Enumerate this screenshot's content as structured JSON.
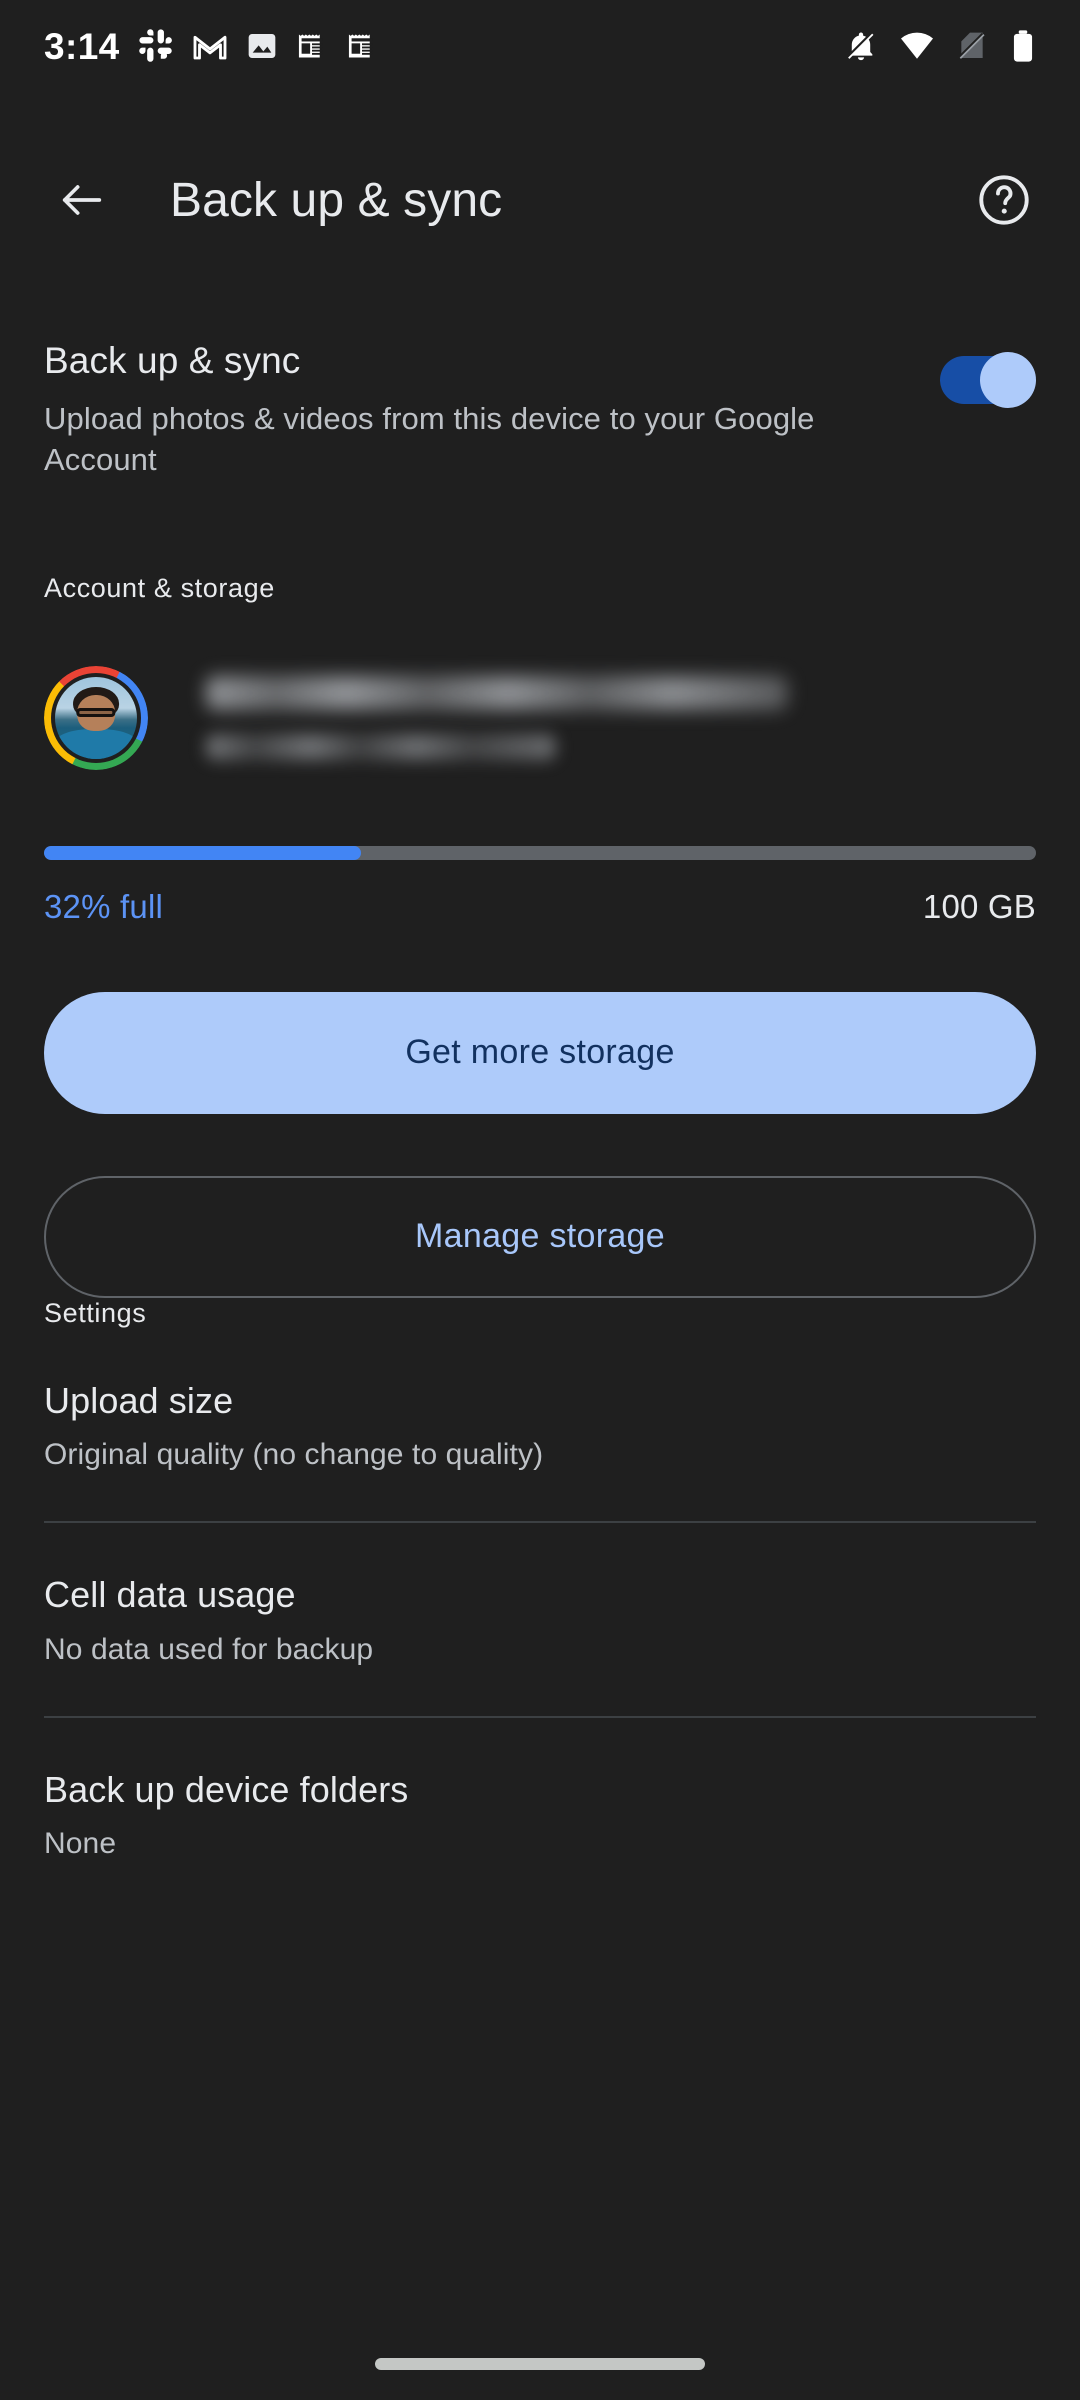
{
  "statusbar": {
    "time": "3:14",
    "left_icons": [
      "slack-icon",
      "gmail-icon",
      "photos-image-icon",
      "news-icon",
      "news-icon-2"
    ],
    "right_icons": [
      "notifications-silenced-icon",
      "wifi-icon",
      "no-sim-icon",
      "battery-full-icon"
    ]
  },
  "appbar": {
    "back_label": "Back",
    "title": "Back up & sync",
    "help_label": "Help"
  },
  "master": {
    "title": "Back up & sync",
    "subtitle": "Upload photos & videos from this device to your Google Account",
    "toggle_state": "on",
    "toggle_track_color": "#174ea6",
    "toggle_thumb_color": "#aecbfa"
  },
  "account_section": {
    "label": "Account & storage",
    "email_redacted": "",
    "usage_redacted": "",
    "storage": {
      "percent_label": "32% full",
      "percent_value": 32,
      "total_label": "100 GB",
      "fill_color": "#4285f4",
      "track_color": "#5f6368",
      "percent_text_color": "#5c93f5"
    },
    "primary_button": "Get more storage",
    "secondary_button": "Manage storage"
  },
  "settings_section": {
    "label": "Settings",
    "items": [
      {
        "title": "Upload size",
        "subtitle": "Original quality (no change to quality)"
      },
      {
        "title": "Cell data usage",
        "subtitle": "No data used for backup"
      },
      {
        "title": "Back up device folders",
        "subtitle": "None"
      }
    ]
  },
  "navbar": {
    "handle": "home-gesture-handle"
  }
}
